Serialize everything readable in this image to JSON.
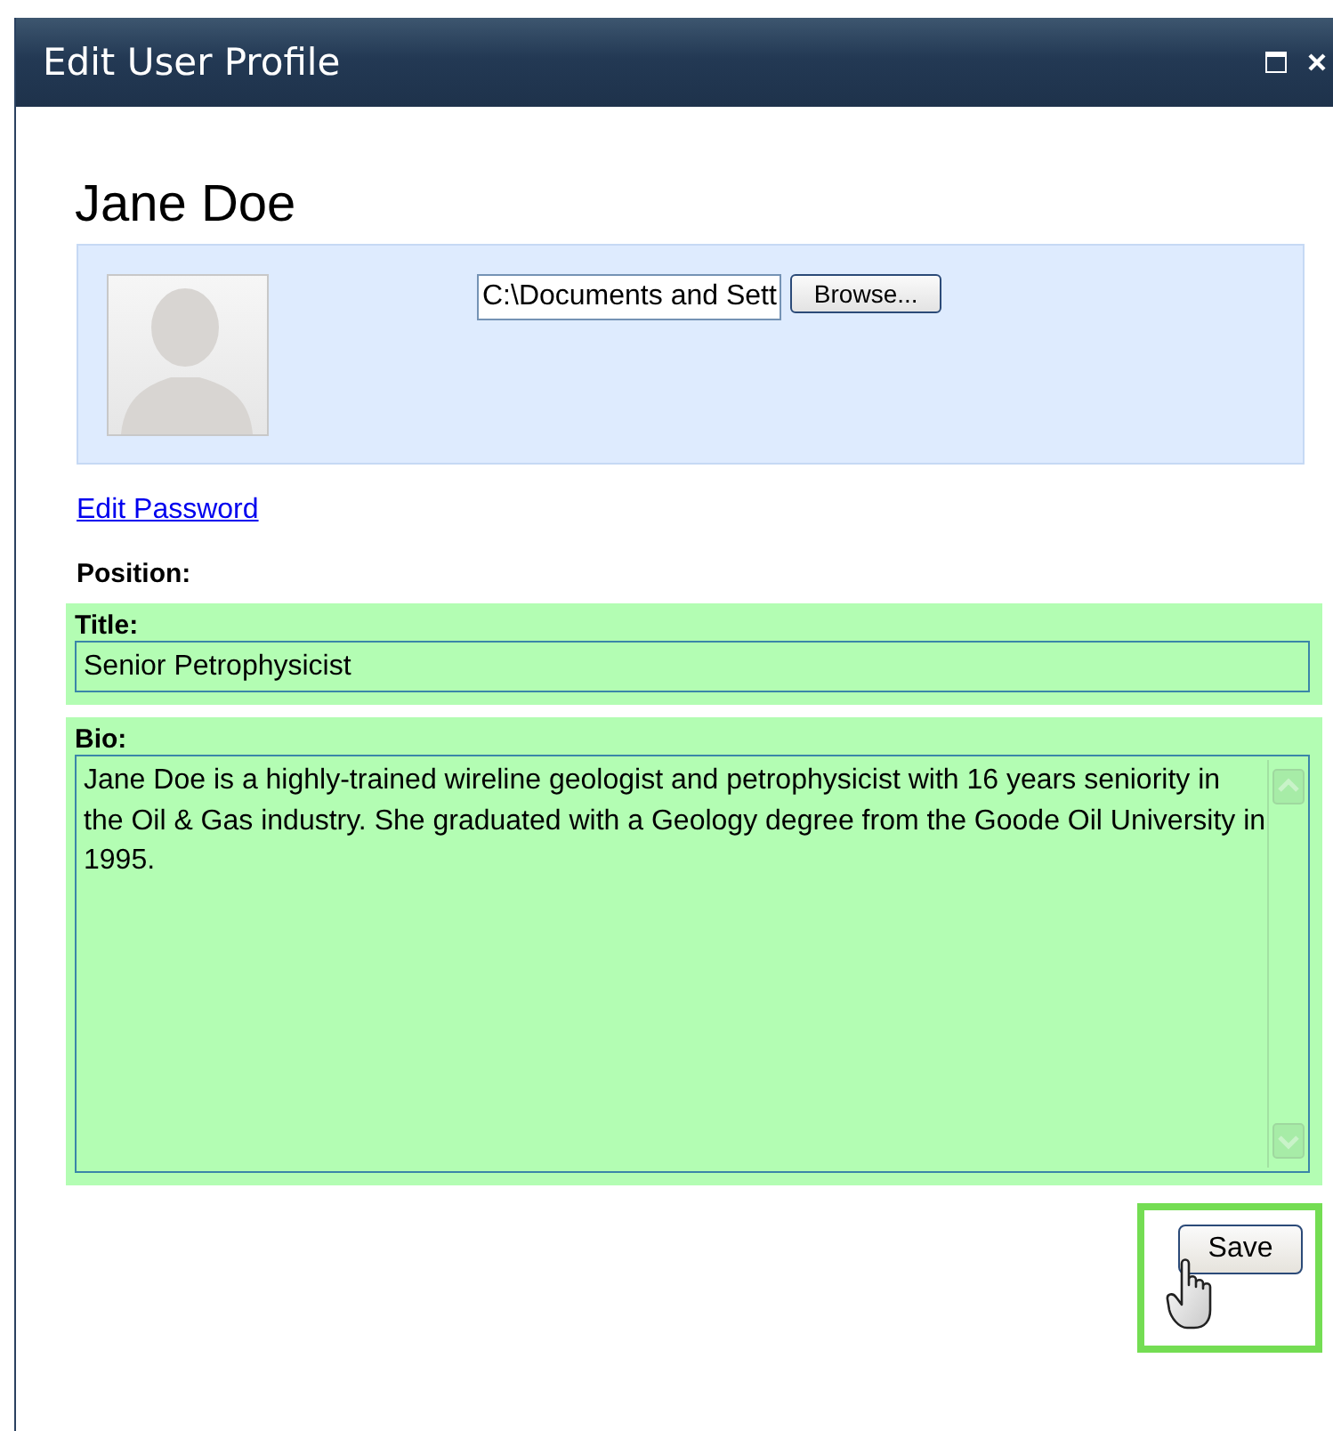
{
  "window": {
    "title": "Edit User Profile"
  },
  "profile": {
    "name": "Jane Doe",
    "file_path": "C:\\Documents and Sett",
    "browse_button": "Browse..."
  },
  "edit_password_link": "Edit Password",
  "position_label": "Position:",
  "fields": [
    {
      "kind": "line",
      "label": "Title:",
      "value": "Senior Petrophysicist",
      "highlighted": true
    },
    {
      "kind": "multiline",
      "label": "Bio:",
      "value": "Jane Doe is a highly-trained wireline geologist and petrophysicist with 16 years seniority in the Oil & Gas industry. She graduated with a Geology degree from the Goode Oil University in 1995.",
      "highlighted": true
    }
  ],
  "save_button": {
    "label": "Save",
    "highlighted": true
  }
}
